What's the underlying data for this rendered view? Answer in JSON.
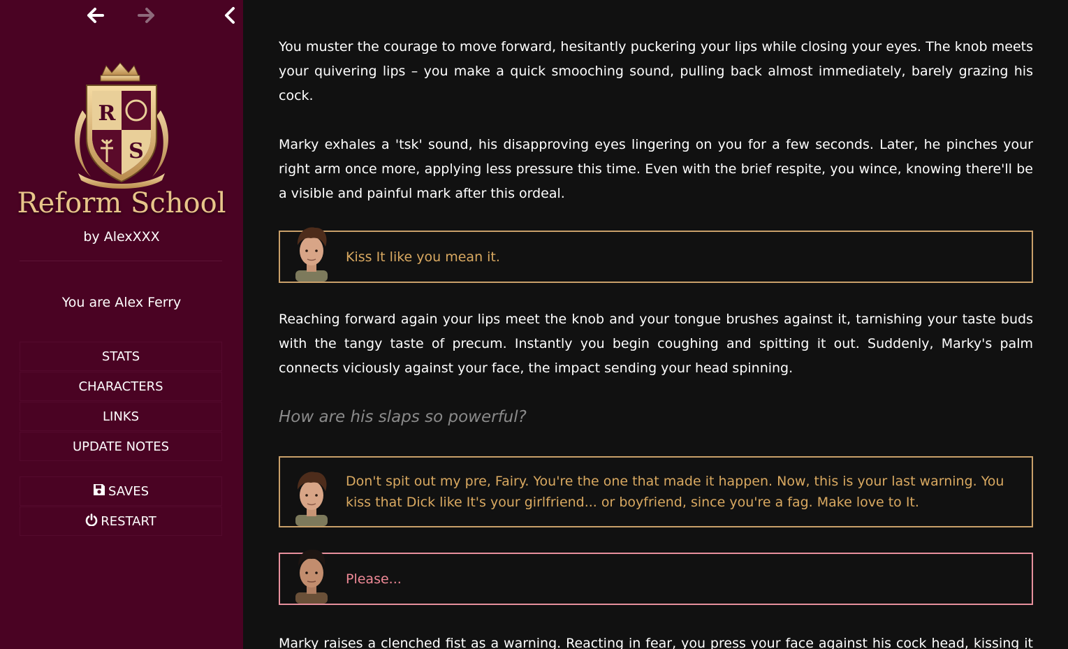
{
  "nav": {
    "back_icon": "arrow-left-icon",
    "forward_icon": "arrow-right-icon",
    "collapse_icon": "chevron-left-icon"
  },
  "sidebar": {
    "logo_letters": [
      "R",
      "S"
    ],
    "title": "Reform School",
    "byline": "by AlexXXX",
    "player_line": "You are Alex Ferry",
    "menu": [
      {
        "label": "STATS"
      },
      {
        "label": "CHARACTERS"
      },
      {
        "label": "LINKS"
      },
      {
        "label": "UPDATE NOTES"
      }
    ],
    "save_menu": [
      {
        "label": "SAVES",
        "icon": "floppy-disk-icon"
      },
      {
        "label": "RESTART",
        "icon": "power-icon"
      }
    ]
  },
  "passage": {
    "p1": "You muster the courage to move forward, hesitantly puckering your lips while closing your eyes. The knob meets your quivering lips – you make a quick smooching sound, pulling back almost immediately, barely grazing his cock.",
    "p2": "Marky exhales a 'tsk' sound, his disapproving eyes lingering on you for a few seconds. Later, he pinches your right arm once more, applying less pressure this time. Even with the brief respite, you wince, knowing there'll be a visible and painful mark after this ordeal.",
    "dialog1": "Kiss It like you mean it.",
    "p3": "Reaching forward again your lips meet the knob and your tongue brushes against it, tarnishing your taste buds with the tangy taste of precum. Instantly you begin coughing and spitting it out. Suddenly, Marky's palm connects viciously against your face, the impact sending your head spinning.",
    "thought": "How are his slaps so powerful?",
    "dialog2": "Don't spit out my pre, Fairy. You're the one that made it happen. Now, this is your last warning. You kiss that Dick like It's your girlfriend... or boyfriend, since you're a fag. Make love to It.",
    "dialog3": "Please...",
    "p4": "Marky raises a clenched fist as a warning. Reacting in fear, you press your face against his cock head, kissing it with open lips. Parting your mouth slightly, you lick the piss slit, eliciting a loud moan from Marky. You gaze up,"
  },
  "colors": {
    "sidebar_bg": "#4a0323",
    "main_bg": "#111111",
    "gold": "#c9a06a",
    "pink": "#e7909d"
  }
}
